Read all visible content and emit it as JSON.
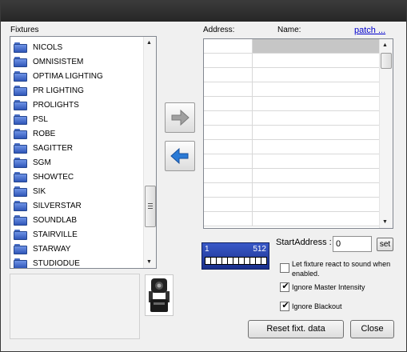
{
  "fixtures_panel": {
    "label": "Fixtures",
    "items": [
      "NICOLS",
      "OMNISISTEM",
      "OPTIMA LIGHTING",
      "PR LIGHTING",
      "PROLIGHTS",
      "PSL",
      "ROBE",
      "SAGITTER",
      "SGM",
      "SHOWTEC",
      "SIK",
      "SILVERSTAR",
      "SOUNDLAB",
      "STAIRVILLE",
      "STARWAY",
      "STUDIODUE"
    ],
    "scroll_up_glyph": "▲",
    "scroll_down_glyph": "▼"
  },
  "transfer": {
    "add_icon": "arrow-right-icon",
    "remove_icon": "arrow-left-icon",
    "add_color": "#9a9a9a",
    "remove_color": "#2a7ad6"
  },
  "patch_grid": {
    "address_header": "Address:",
    "name_header": "Name:",
    "patch_link": "patch ...",
    "scroll_up_glyph": "▲",
    "scroll_down_glyph": "▼"
  },
  "dmx_range": {
    "start": "1",
    "end": "512",
    "bar_color": "#2a47b8"
  },
  "start_address": {
    "label": "StartAddress :",
    "value": "0",
    "set_label": "set"
  },
  "options": [
    {
      "label": "Let fixture react to sound when enabled.",
      "checked": false
    },
    {
      "label": "Ignore Master Intensity",
      "checked": true
    },
    {
      "label": "Ignore Blackout",
      "checked": true
    }
  ],
  "footer": {
    "reset_label": "Reset fixt. data",
    "close_label": "Close"
  },
  "check_glyph": "✔"
}
